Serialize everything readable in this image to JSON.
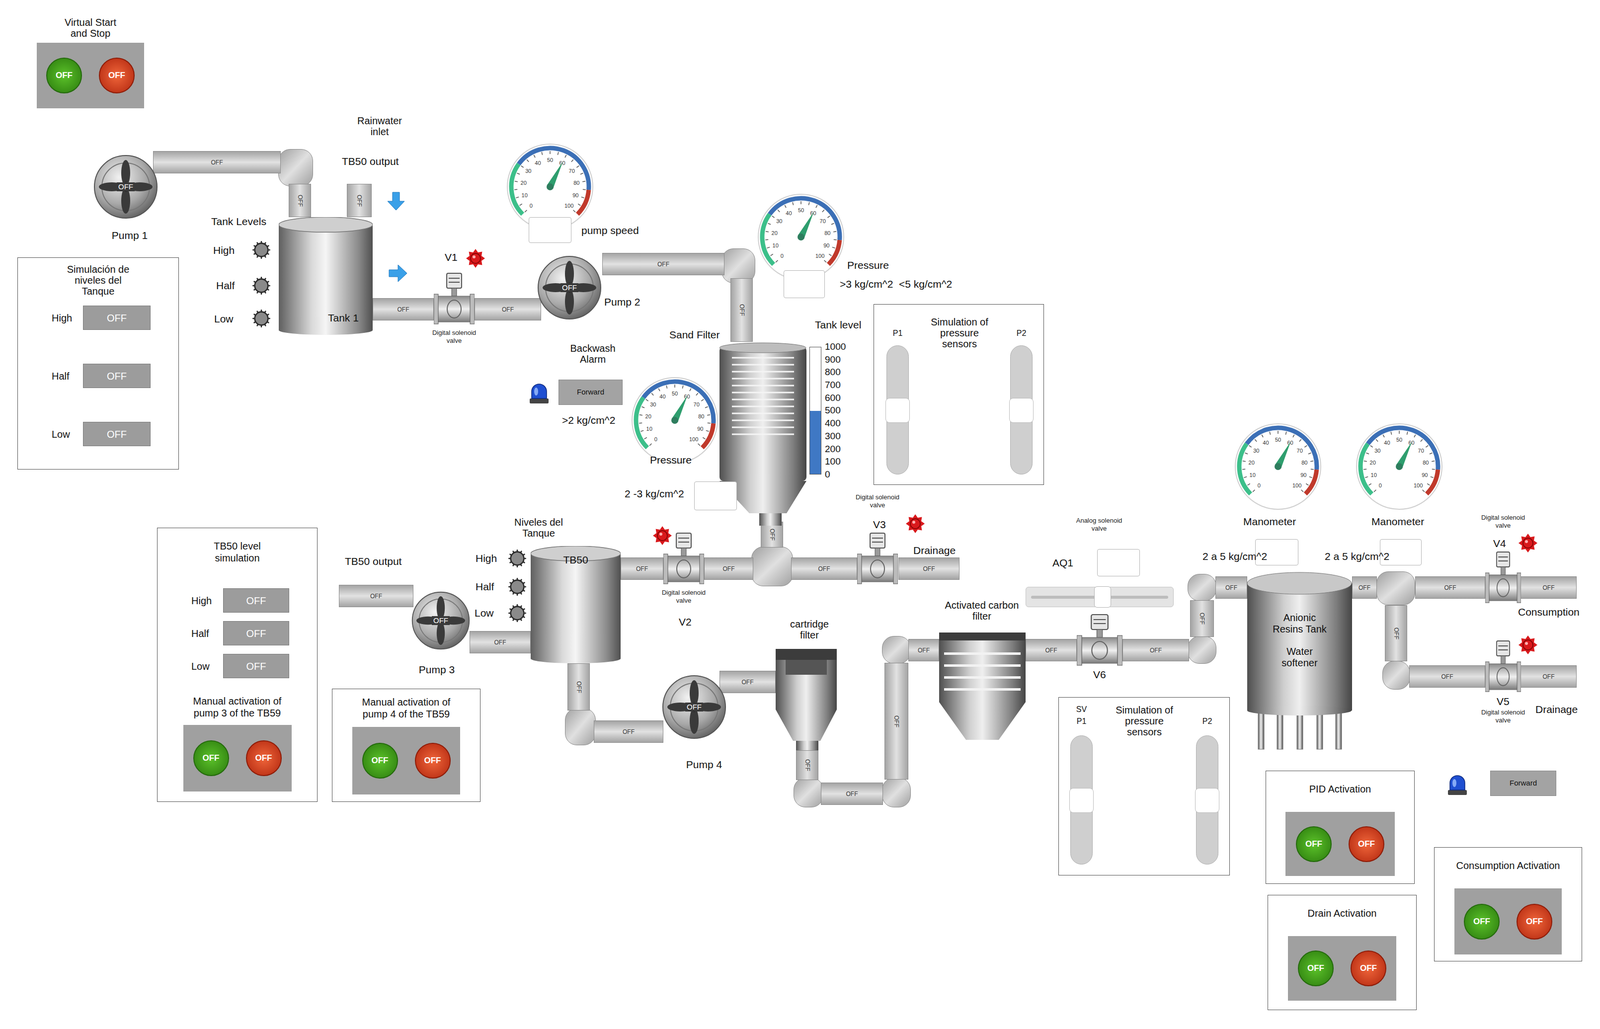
{
  "virtual_start_stop": {
    "title": "Virtual Start and Stop",
    "buttons": [
      {
        "label": "OFF",
        "kind": "start"
      },
      {
        "label": "OFF",
        "kind": "stop"
      }
    ]
  },
  "pumps": [
    {
      "name": "Pump 1",
      "label": "OFF",
      "on": false
    },
    {
      "name": "Pump 2",
      "label": "OFF",
      "on": false
    },
    {
      "name": "Pump 3",
      "label": "OFF",
      "on": false
    },
    {
      "name": "Pump 4",
      "label": "OFF",
      "on": false
    }
  ],
  "pipes": [
    {
      "label": "OFF"
    },
    {
      "label": "OFF"
    },
    {
      "label": "OFF"
    },
    {
      "label": "OFF"
    },
    {
      "label": "OFF"
    },
    {
      "label": "OFF"
    },
    {
      "label": "OFF"
    },
    {
      "label": "OFF"
    },
    {
      "label": "OFF"
    },
    {
      "label": "OFF"
    },
    {
      "label": "OFF"
    },
    {
      "label": "OFF"
    },
    {
      "label": "OFF"
    },
    {
      "label": "OFF"
    },
    {
      "label": "OFF"
    },
    {
      "label": "OFF"
    },
    {
      "label": "OFF"
    },
    {
      "label": "OFF"
    },
    {
      "label": "OFF"
    },
    {
      "label": "OFF"
    },
    {
      "label": "OFF"
    },
    {
      "label": "OFF"
    },
    {
      "label": "OFF"
    },
    {
      "label": "OFF"
    },
    {
      "label": "OFF"
    },
    {
      "label": "OFF"
    },
    {
      "label": "OFF"
    },
    {
      "label": "OFF"
    },
    {
      "label": "OFF"
    },
    {
      "label": "OFF"
    },
    {
      "label": "OFF"
    }
  ],
  "labels": {
    "rainwater_inlet": "Rainwater inlet",
    "tb50_output_top": "TB50 output",
    "tb50_output_bottom": "TB50 output",
    "sand_filter": "Sand Filter",
    "cartridge_filter": "cartridge filter",
    "carbon_filter": "Activated carbon filter",
    "drainage_filter": "Drainage",
    "consumption": "Consumption",
    "drainage_softener": "Drainage"
  },
  "tank1": {
    "name": "Tank 1",
    "levels_title": "Tank Levels",
    "levels": [
      {
        "label": "High",
        "on": false
      },
      {
        "label": "Half",
        "on": false
      },
      {
        "label": "Low",
        "on": false
      }
    ]
  },
  "tb50": {
    "name": "TB50",
    "levels_title": "Niveles del Tanque",
    "levels": [
      {
        "label": "High",
        "on": false
      },
      {
        "label": "Half",
        "on": false
      },
      {
        "label": "Low",
        "on": false
      }
    ]
  },
  "tank_level_sim": {
    "title": "Simulación de niveles del Tanque",
    "rows": [
      {
        "label": "High",
        "value": "OFF"
      },
      {
        "label": "Half",
        "value": "OFF"
      },
      {
        "label": "Low",
        "value": "OFF"
      }
    ]
  },
  "tb50_level_sim": {
    "title": "TB50 level simulation",
    "rows": [
      {
        "label": "High",
        "value": "OFF"
      },
      {
        "label": "Half",
        "value": "OFF"
      },
      {
        "label": "Low",
        "value": "OFF"
      }
    ],
    "pump3_title": "Manual activation of pump 3 of the TB59",
    "pump3_buttons": [
      {
        "label": "OFF",
        "kind": "start"
      },
      {
        "label": "OFF",
        "kind": "stop"
      }
    ]
  },
  "pump4_manual": {
    "title": "Manual activation of pump 4 of the TB59",
    "buttons": [
      {
        "label": "OFF",
        "kind": "start"
      },
      {
        "label": "OFF",
        "kind": "stop"
      }
    ]
  },
  "gauge_scale": [
    "0",
    "10",
    "20",
    "30",
    "40",
    "50",
    "60",
    "70",
    "80",
    "90",
    "100"
  ],
  "gauges": [
    {
      "caption": "pump speed",
      "reading": "",
      "level": 0.6
    },
    {
      "caption": "Pressure",
      "range": ">3 kg/cm^2  <5 kg/cm^2",
      "reading": "",
      "level": 0.6
    },
    {
      "caption": "Pressure",
      "range": "2 -3 kg/cm^2",
      "reading": "",
      "level": 0.6
    },
    {
      "caption": "Manometer",
      "range": "2 a 5 kg/cm^2",
      "reading": "",
      "level": 0.6
    },
    {
      "caption": "Manometer",
      "range": "2 a 5 kg/cm^2",
      "reading": "",
      "level": 0.6
    }
  ],
  "valves": [
    {
      "name": "V1",
      "caption": "Digital solenoid valve",
      "open": false
    },
    {
      "name": "V2",
      "caption": "Digital solenoid valve",
      "open": false
    },
    {
      "name": "V3",
      "caption": "Digital solenoid valve",
      "open": false
    },
    {
      "name": "V4",
      "caption": "Digital solenoid valve",
      "open": false
    },
    {
      "name": "V5",
      "caption": "Digital solenoid valve",
      "open": false
    }
  ],
  "analog_valve": {
    "name": "V6",
    "caption": "Analog solenoid valve",
    "output": "AQ1",
    "reading": "",
    "level": 0.52
  },
  "filter_tank_level": {
    "title": "Tank level",
    "ticks": [
      "1000",
      "900",
      "800",
      "700",
      "600",
      "500",
      "400",
      "300",
      "200",
      "100",
      "0"
    ],
    "level": 0.5
  },
  "pressure_sim_1": {
    "title": "Simulation of pressure sensors",
    "sensors": [
      {
        "label": "P1",
        "level": 0.5
      },
      {
        "label": "P2",
        "level": 0.5
      }
    ]
  },
  "pressure_sim_2": {
    "prefix": "SV",
    "title": "Simulation of pressure sensors",
    "sensors": [
      {
        "label": "P1",
        "level": 0.5
      },
      {
        "label": "P2",
        "level": 0.5
      }
    ]
  },
  "backwash_alarm": {
    "title": "Backwash Alarm",
    "status": "Forward",
    "threshold": ">2 kg/cm^2",
    "on": false
  },
  "softener_alarm": {
    "status": "Forward",
    "on": false
  },
  "resin_tank": {
    "name": "Anionic Resins Tank",
    "subtitle": "Water softener"
  },
  "activations": [
    {
      "title": "PID Activation",
      "buttons": [
        {
          "label": "OFF",
          "kind": "start"
        },
        {
          "label": "OFF",
          "kind": "stop"
        }
      ]
    },
    {
      "title": "Drain Activation",
      "buttons": [
        {
          "label": "OFF",
          "kind": "start"
        },
        {
          "label": "OFF",
          "kind": "stop"
        }
      ]
    },
    {
      "title": "Consumption Activation",
      "buttons": [
        {
          "label": "OFF",
          "kind": "start"
        },
        {
          "label": "OFF",
          "kind": "stop"
        }
      ]
    }
  ]
}
